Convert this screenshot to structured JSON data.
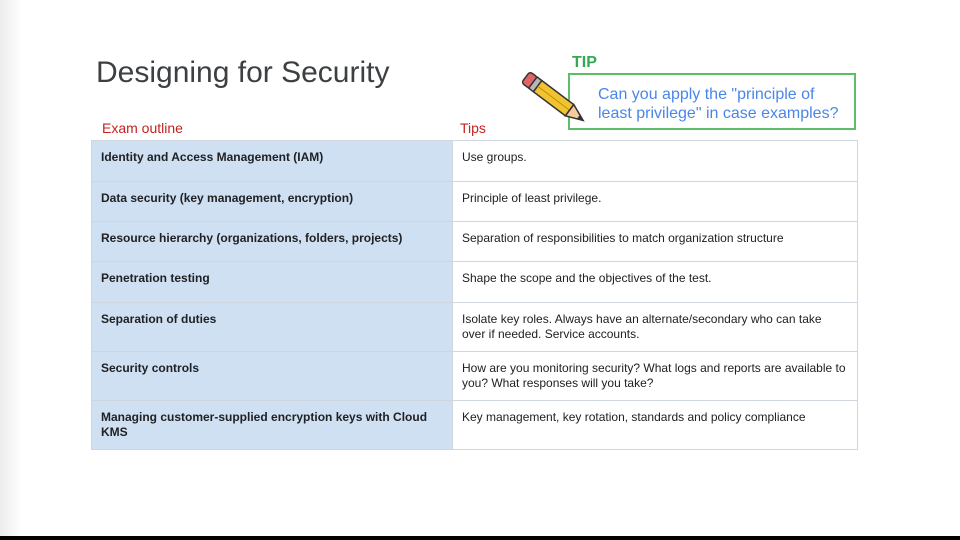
{
  "slide": {
    "title": "Designing for Security"
  },
  "tip": {
    "label": "TIP",
    "line1": "Can you apply the \"principle of",
    "line2": "least privilege\" in case examples?"
  },
  "columns": {
    "outline": "Exam outline",
    "tips": "Tips"
  },
  "rows": [
    {
      "topic": "Identity and Access Management (IAM)",
      "tip": "Use groups."
    },
    {
      "topic": "Data security (key management, encryption)",
      "tip": "Principle of least privilege."
    },
    {
      "topic": "Resource hierarchy (organizations, folders, projects)",
      "tip": "Separation of responsibilities to match organization structure"
    },
    {
      "topic": "Penetration testing",
      "tip": "Shape the scope and the objectives of the test."
    },
    {
      "topic": "Separation of duties",
      "tip": "Isolate key roles. Always have an alternate/secondary who can take over if needed. Service accounts."
    },
    {
      "topic": "Security controls",
      "tip": "How are you monitoring security? What logs and reports are available to you? What responses will you take?"
    },
    {
      "topic": "Managing customer-supplied encryption keys with Cloud KMS",
      "tip": "Key management, key rotation, standards and policy compliance"
    }
  ],
  "icons": {
    "pencil": "pencil-icon"
  }
}
